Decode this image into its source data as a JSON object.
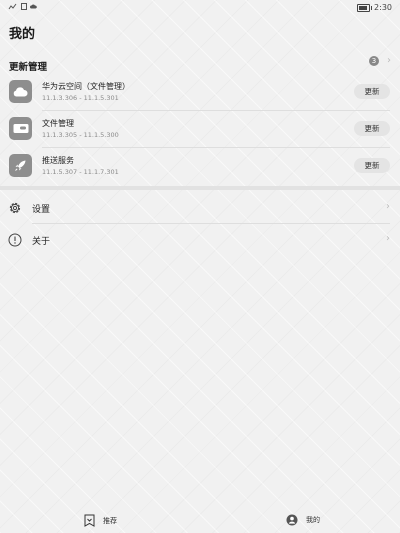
{
  "statusbar": {
    "time": "2:30"
  },
  "page": {
    "title": "我的"
  },
  "updates": {
    "title": "更新管理",
    "count": "3",
    "apps": [
      {
        "name": "华为云空间（文件管理）",
        "version": "11.1.3.306 - 11.1.5.301",
        "action": "更新",
        "icon": "cloud-icon"
      },
      {
        "name": "文件管理",
        "version": "11.1.3.305 - 11.1.5.300",
        "action": "更新",
        "icon": "folder-icon"
      },
      {
        "name": "推送服务",
        "version": "11.1.5.307 - 11.1.7.301",
        "action": "更新",
        "icon": "rocket-icon"
      }
    ]
  },
  "menu": {
    "settings": {
      "label": "设置",
      "icon": "gear-icon"
    },
    "about": {
      "label": "关于",
      "icon": "info-icon"
    }
  },
  "bottom_nav": {
    "recommend": {
      "label": "推荐",
      "icon": "recommend-icon"
    },
    "mine": {
      "label": "我的",
      "icon": "person-icon"
    }
  },
  "colors": {
    "icon_bg": "#8e8e8e",
    "button_bg": "#e4e4e4",
    "background": "#f1f1f1"
  }
}
